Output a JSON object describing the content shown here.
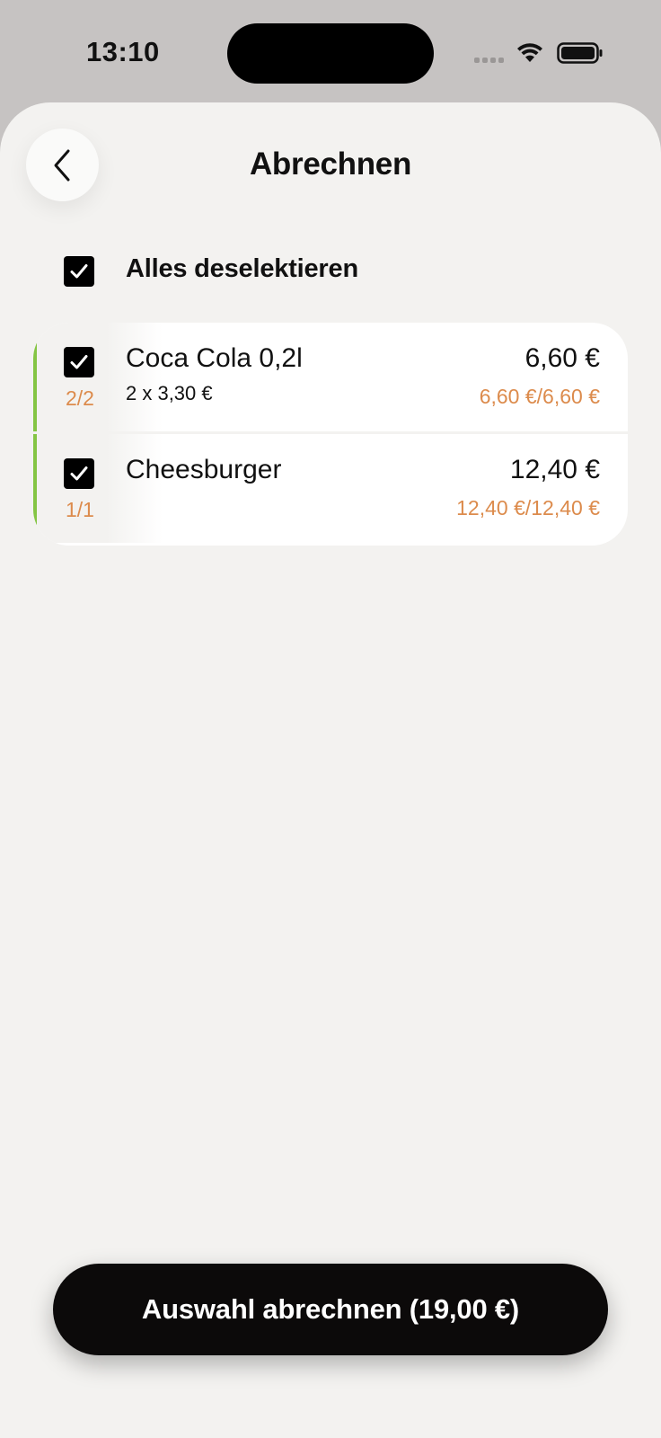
{
  "status_bar": {
    "time": "13:10"
  },
  "header": {
    "title": "Abrechnen",
    "back_icon": "chevron-left-icon"
  },
  "select_all": {
    "label": "Alles deselektieren",
    "checked": true
  },
  "items": [
    {
      "name": "Coca Cola 0,2l",
      "detail": "2 x 3,30 €",
      "price": "6,60 €",
      "paid": "6,60 €/6,60 €",
      "quantity": "2/2",
      "checked": true
    },
    {
      "name": "Cheesburger",
      "detail": "",
      "price": "12,40 €",
      "paid": "12,40 €/12,40 €",
      "quantity": "1/1",
      "checked": true
    }
  ],
  "checkout": {
    "label": "Auswahl abrechnen (19,00 €)"
  },
  "colors": {
    "accent_green": "#84c544",
    "accent_orange": "#dc8b4c",
    "button_dark": "#0c0a0a",
    "sheet_bg": "#f3f2f0"
  }
}
